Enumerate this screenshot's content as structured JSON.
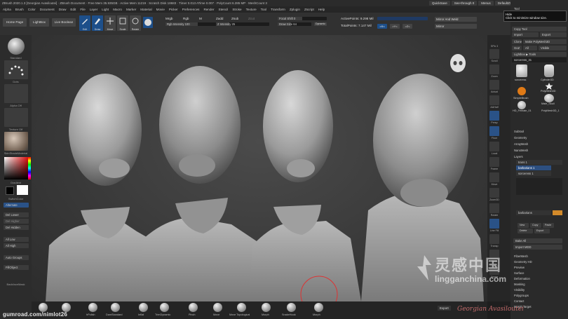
{
  "window": {
    "title": "ZBrush 2020.1.3 [Georgian Avasiloutei] · ZBrush Document · Free Mem 35.935GB · Active Mem 11219 · Scratch Disk 18683 · Timer 0.013 ATime 0.007 · PolyCount 6.285 MP · MeshCount 3",
    "quicksave": "QuickSave",
    "see_through": "See-through 0",
    "menus_label": "Menus",
    "default_script": "DefaultZScript"
  },
  "menus": [
    "Alpha",
    "Brush",
    "Color",
    "Document",
    "Draw",
    "Edit",
    "File",
    "Layer",
    "Light",
    "Macro",
    "Marker",
    "Material",
    "Movie",
    "Picker",
    "Preferences",
    "Render",
    "Stencil",
    "Stroke",
    "Texture",
    "Tool",
    "Transform",
    "Zplugin",
    "Zscript",
    "Help"
  ],
  "toolbar": {
    "home_page": "Home Page",
    "lightbox": "LightBox",
    "live_boolean": "Live Boolean",
    "edit": "Edit",
    "draw": "Draw",
    "move": "Move",
    "scale": "Scale",
    "rotate": "Rotate",
    "mrgb": "Mrgb",
    "rgb": "Rgb",
    "m": "M",
    "zadd": "Zadd",
    "zsub": "Zsub",
    "zcut": "Zcut",
    "rgb_intensity": "Rgb Intensity 100",
    "z_intensity": "Z Intensity 25",
    "focal_shift": "Focal Shift 0",
    "draw_size": "Draw Size 64",
    "dynamic": "Dynamic",
    "active_points": "ActivePoints: 9.298 Mil",
    "total_points": "TotalPoints: 7.147 Mil",
    "mirror_and_weld": "Mirror And Weld",
    "mirror": "Mirror",
    "axis_x": ">X<",
    "axis_y": ">Y<",
    "axis_z": ">Z<"
  },
  "left_shelf": {
    "brush_label": "Standard",
    "stroke_label": "Dots",
    "alpha_label": "Alpha Off",
    "texture_label": "Texture Off",
    "material_label": "SkinShadeMaterial",
    "gradient": "Gradient",
    "switch_color": "SwitchColor",
    "alternate": "Alternate",
    "buttons": [
      "Del Lower",
      "Del Higher",
      "Del Hidden",
      "All Low",
      "All High",
      "Auto Groups",
      "FillObject"
    ],
    "backface_mask": "BackfaceMask"
  },
  "right_strip": [
    "SPix 3",
    "Scroll",
    "Zoom",
    "Actual",
    "AAHalf",
    "Persp",
    "Floor",
    "Local",
    "Frame",
    "Move",
    "Zoom3D",
    "Rotate",
    "Line Fill",
    "Transp",
    "Solo",
    "Xpose"
  ],
  "palette": {
    "tool": "Tool",
    "tooltip_title": "Hide",
    "tooltip_text": "Click to minimize window size.",
    "copy_tool": "Copy Tool",
    "import": "Import",
    "export": "Export",
    "clone": "Clone",
    "make_polymesh": "Make PolyMesh3D",
    "goz": "GoZ",
    "all": "All",
    "visible": "Visible",
    "lightbox_tools": "Lightbox ▶ Tools",
    "sorceress": "sorceress_31",
    "tools": [
      "sorceress",
      "Cylinder3D",
      "PolyMesh3D",
      "SimpleBrush",
      "Male_Skull",
      "HD_Female_01",
      "PolyMesh3D_1"
    ],
    "sections": [
      "Subtool",
      "Geometry",
      "ArrayMesh",
      "NanoMesh",
      "Layers"
    ],
    "layers": [
      "trans 1",
      "barbarians 1",
      "sorceress 1"
    ],
    "layer_bottom": "barbarians",
    "bake_all": "Bake All",
    "import_mdd": "Import MDD",
    "lower_sections": [
      "FiberMesh",
      "Geometry HD",
      "Preview",
      "Surface",
      "Deformation",
      "Masking",
      "Visibility",
      "Polygroups",
      "Contact",
      "Morph Target"
    ],
    "new": "New",
    "copy": "Copy",
    "paste": "Paste",
    "delete": "Delete",
    "export_btn": "Export"
  },
  "bottom_shelf": [
    "hPolish",
    "DamStandard",
    "Inflat",
    "TrimDynamic",
    "Pinch",
    "Move",
    "Move Topological",
    "Morph",
    "SnakeHook",
    "Morph"
  ],
  "overlay": {
    "gumroad": "gumroad.com/nimlot26",
    "signature": "Georgian Avasiloutei",
    "watermark_cn": "灵感中国",
    "watermark_en": "lingganchina.com"
  },
  "colors": {
    "accent_blue": "#1d4f8a",
    "viewport_bg": "#3a3a3a",
    "signature": "#c26a6a",
    "orange_slider": "#d38a2a"
  }
}
